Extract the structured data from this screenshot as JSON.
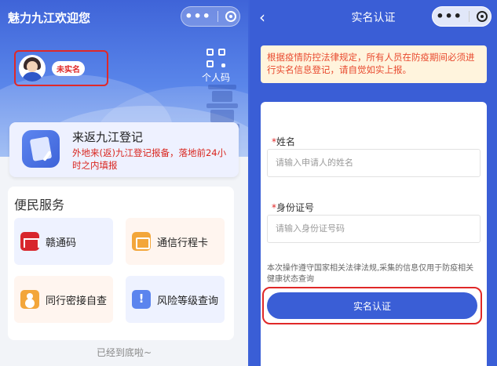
{
  "left": {
    "header_title": "魅力九江欢迎您",
    "capsule": {
      "more": "•••"
    },
    "user": {
      "status_badge": "未实名"
    },
    "qr": {
      "label": "个人码"
    },
    "return_card": {
      "title": "来返九江登记",
      "description": "外地来(返)九江登记报备，落地前24小时之内填报"
    },
    "services": {
      "title": "便民服务",
      "items": [
        {
          "label": "赣通码",
          "icon": "gan-tong-code-icon"
        },
        {
          "label": "通信行程卡",
          "icon": "trip-card-icon"
        },
        {
          "label": "同行密接自查",
          "icon": "peer-contact-icon"
        },
        {
          "label": "风险等级查询",
          "icon": "risk-warning-icon"
        }
      ]
    },
    "footer_tip": "已经到底啦~"
  },
  "right": {
    "nav": {
      "back": "‹",
      "title": "实名认证"
    },
    "capsule": {
      "more": "•••"
    },
    "notice": "根据疫情防控法律规定，所有人员在防疫期间必须进行实名信息登记，请自觉如实上报。",
    "form": {
      "name": {
        "required_mark": "*",
        "label": "姓名",
        "placeholder": "请输入申请人的姓名"
      },
      "id_number": {
        "required_mark": "*",
        "label": "身份证号",
        "placeholder": "请输入身份证号码"
      },
      "legal_note": "本次操作遵守国家相关法律法规,采集的信息仅用于防疫相关健康状态查询",
      "submit_label": "实名认证"
    }
  },
  "colors": {
    "primary": "#3a5ed6",
    "alert_red": "#e02828",
    "notice_bg": "#fff4dd",
    "notice_text": "#e8492e"
  }
}
